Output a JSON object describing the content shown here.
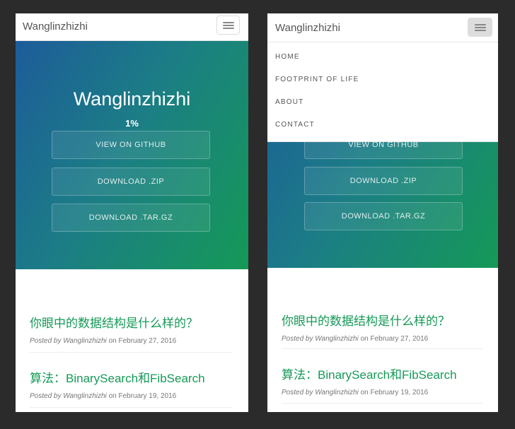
{
  "brand": "Wanglinzhizhi",
  "hero": {
    "title": "Wanglinzhizhi",
    "progress": "1%",
    "buttons": [
      "VIEW ON GITHUB",
      "DOWNLOAD .ZIP",
      "DOWNLOAD .TAR.GZ"
    ]
  },
  "menu": [
    "HOME",
    "FOOTPRINT OF LIFE",
    "ABOUT",
    "CONTACT"
  ],
  "posts": [
    {
      "title": "你眼中的数据结构是什么样的？",
      "posted_by": "Posted by",
      "author": "Wanglinzhizhi",
      "on": "on",
      "date": "February 27, 2016"
    },
    {
      "title": "算法：BinarySearch和FibSearch",
      "posted_by": "Posted by",
      "author": "Wanglinzhizhi",
      "on": "on",
      "date": "February 19, 2016"
    }
  ],
  "colors": {
    "accent": "#159957",
    "hero_start": "#1d5c9a",
    "hero_end": "#159957",
    "background": "#2b2b2b"
  },
  "icons": {
    "menu_toggle": "hamburger-icon"
  }
}
